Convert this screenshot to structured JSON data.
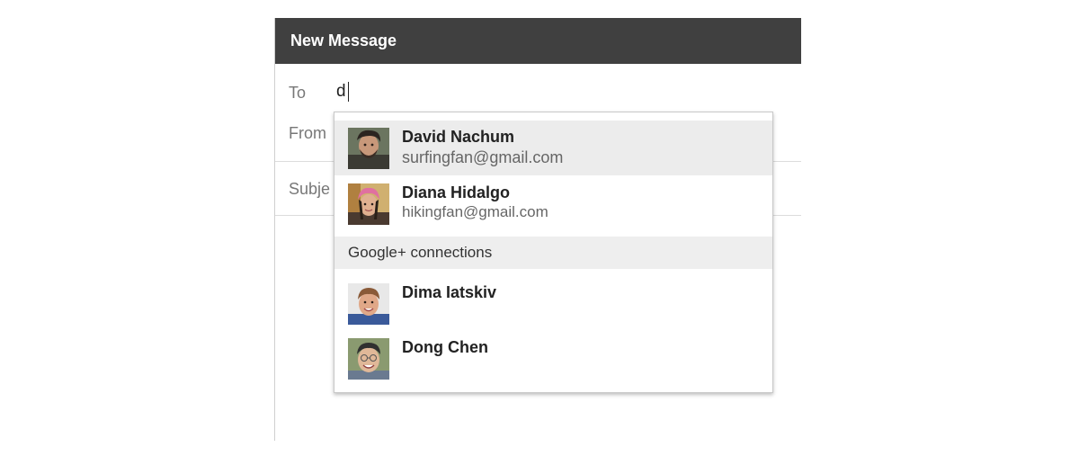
{
  "compose": {
    "title": "New Message",
    "to_label": "To",
    "to_value": "d",
    "from_label": "From",
    "subject_label": "Subje"
  },
  "autocomplete": {
    "suggestions": [
      {
        "name": "David Nachum",
        "email": "surfingfan@gmail.com",
        "avatar_icon": "user-avatar"
      },
      {
        "name": "Diana Hidalgo",
        "email": "hikingfan@gmail.com",
        "avatar_icon": "user-avatar"
      }
    ],
    "section_label": "Google+ connections",
    "connections": [
      {
        "name": "Dima Iatskiv",
        "avatar_icon": "user-avatar"
      },
      {
        "name": "Dong Chen",
        "avatar_icon": "user-avatar"
      }
    ]
  },
  "colors": {
    "header_bg": "#404040",
    "selected_row": "#ececec",
    "section_bg": "#eeeeee"
  }
}
